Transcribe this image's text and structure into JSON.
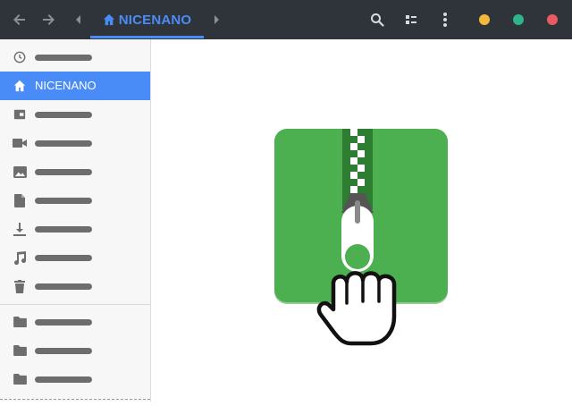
{
  "header": {
    "breadcrumb_label": "NICENANO",
    "icons": [
      "back-arrow-icon",
      "forward-arrow-icon",
      "chevron-left-icon",
      "home-icon",
      "chevron-right-icon",
      "search-icon",
      "view-list-icon",
      "more-vertical-icon"
    ],
    "window_dots": [
      {
        "name": "minimize",
        "color": "#f1b83a"
      },
      {
        "name": "maximize",
        "color": "#2fb38a"
      },
      {
        "name": "close",
        "color": "#e85b60"
      }
    ]
  },
  "sidebar": {
    "items": [
      {
        "icon": "recent-icon",
        "label": ""
      },
      {
        "icon": "home-icon",
        "label": "NICENANO",
        "active": true
      },
      {
        "icon": "desktop-icon",
        "label": ""
      },
      {
        "icon": "video-icon",
        "label": ""
      },
      {
        "icon": "image-icon",
        "label": ""
      },
      {
        "icon": "document-icon",
        "label": ""
      },
      {
        "icon": "download-icon",
        "label": ""
      },
      {
        "icon": "music-icon",
        "label": ""
      },
      {
        "icon": "trash-icon",
        "label": ""
      },
      {
        "icon": "folder-icon",
        "label": ""
      },
      {
        "icon": "folder-icon",
        "label": ""
      },
      {
        "icon": "folder-icon",
        "label": ""
      }
    ]
  },
  "colors": {
    "header_bg": "#2f343b",
    "accent": "#4a8cf7",
    "archive_green": "#4caf50",
    "zipper_dark": "#2e7d32"
  },
  "main": {
    "illustration": "zip-archive-icon-with-hand-cursor"
  }
}
